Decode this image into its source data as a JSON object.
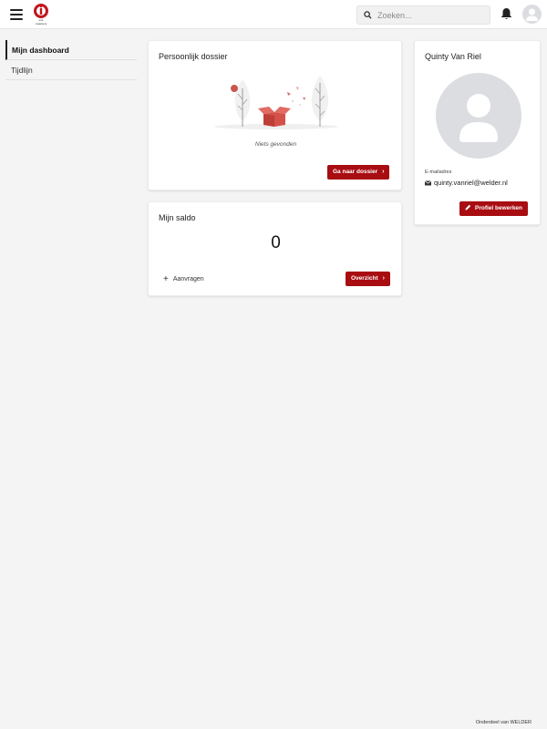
{
  "header": {
    "logo_text_line1": "sint",
    "logo_text_line2": "maartens",
    "search": {
      "placeholder": "Zoeken..."
    }
  },
  "sidebar": {
    "items": [
      {
        "label": "Mijn dashboard",
        "active": true
      },
      {
        "label": "Tijdlijn",
        "active": false
      }
    ]
  },
  "dossier": {
    "title": "Persoonlijk dossier",
    "empty_text": "Niets gevonden",
    "button_label": "Ga naar dossier"
  },
  "saldo": {
    "title": "Mijn saldo",
    "value": "0",
    "request_label": "Aanvragen",
    "overview_label": "Overzicht"
  },
  "profile": {
    "name": "Quinty Van Riel",
    "email_label": "E-mailadres",
    "email": "quinty.vanriel@welder.nl",
    "edit_label": "Profiel bewerken"
  },
  "footer": {
    "text": "Onderdeel van WELDER"
  },
  "colors": {
    "accent": "#a80d12",
    "background": "#f4f4f4",
    "avatar_bg": "#dcdde1"
  },
  "icons": [
    "menu-icon",
    "search-icon",
    "bell-icon",
    "user-icon",
    "plus-icon",
    "chevron-right-icon",
    "envelope-icon",
    "pencil-icon"
  ]
}
